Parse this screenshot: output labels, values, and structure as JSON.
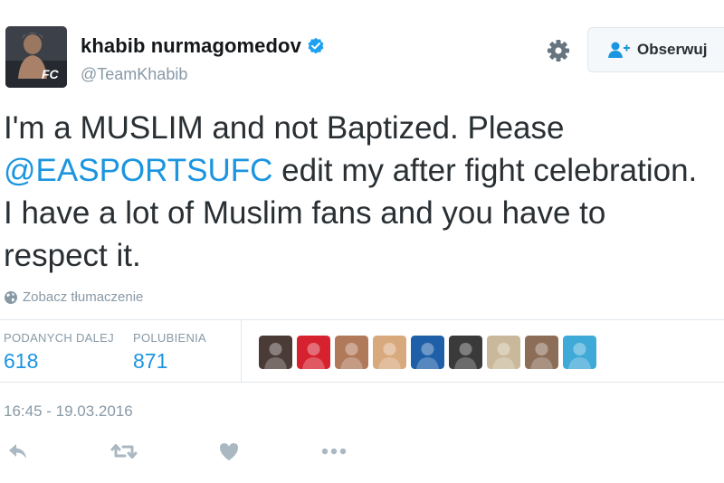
{
  "user": {
    "display_name": "khabib nurmagomedov",
    "handle": "@TeamKhabib"
  },
  "follow_button": {
    "label": "Obserwuj"
  },
  "tweet": {
    "lines": [
      {
        "before": "I'm a MUSLIM and not Baptized. Please",
        "mention": "",
        "after": ""
      },
      {
        "before": "",
        "mention": "@EASPORTSUFC",
        "after": " edit my after fight celebration."
      },
      {
        "before": "I have a lot of Muslim fans and you have to",
        "mention": "",
        "after": ""
      },
      {
        "before": "respect it.",
        "mention": "",
        "after": ""
      }
    ]
  },
  "translate": {
    "label": "Zobacz tłumaczenie"
  },
  "stats": {
    "retweets": {
      "label": "PODANYCH DALEJ",
      "value": "618"
    },
    "likes": {
      "label": "POLUBIENIA",
      "value": "871"
    }
  },
  "likers": [
    {
      "icon": "liker-avatar-1",
      "color": "#4a3b36"
    },
    {
      "icon": "liker-avatar-2",
      "color": "#d6212e"
    },
    {
      "icon": "liker-avatar-3",
      "color": "#b07a5a"
    },
    {
      "icon": "liker-avatar-4",
      "color": "#d9a97e"
    },
    {
      "icon": "liker-avatar-5",
      "color": "#1e5fa8"
    },
    {
      "icon": "liker-avatar-6",
      "color": "#3a3a3a"
    },
    {
      "icon": "liker-avatar-7",
      "color": "#c9b99a"
    },
    {
      "icon": "liker-avatar-8",
      "color": "#8c6e58"
    },
    {
      "icon": "liker-avatar-9",
      "color": "#3fa9d8"
    }
  ],
  "timestamp": "16:45 - 19.03.2016",
  "colors": {
    "accent": "#1b95e0",
    "text": "#292f33",
    "muted": "#8899a6",
    "icon": "#aab8c2",
    "border": "#e1e8ed"
  },
  "actions": [
    "reply-icon",
    "retweet-icon",
    "like-icon",
    "more-icon"
  ]
}
